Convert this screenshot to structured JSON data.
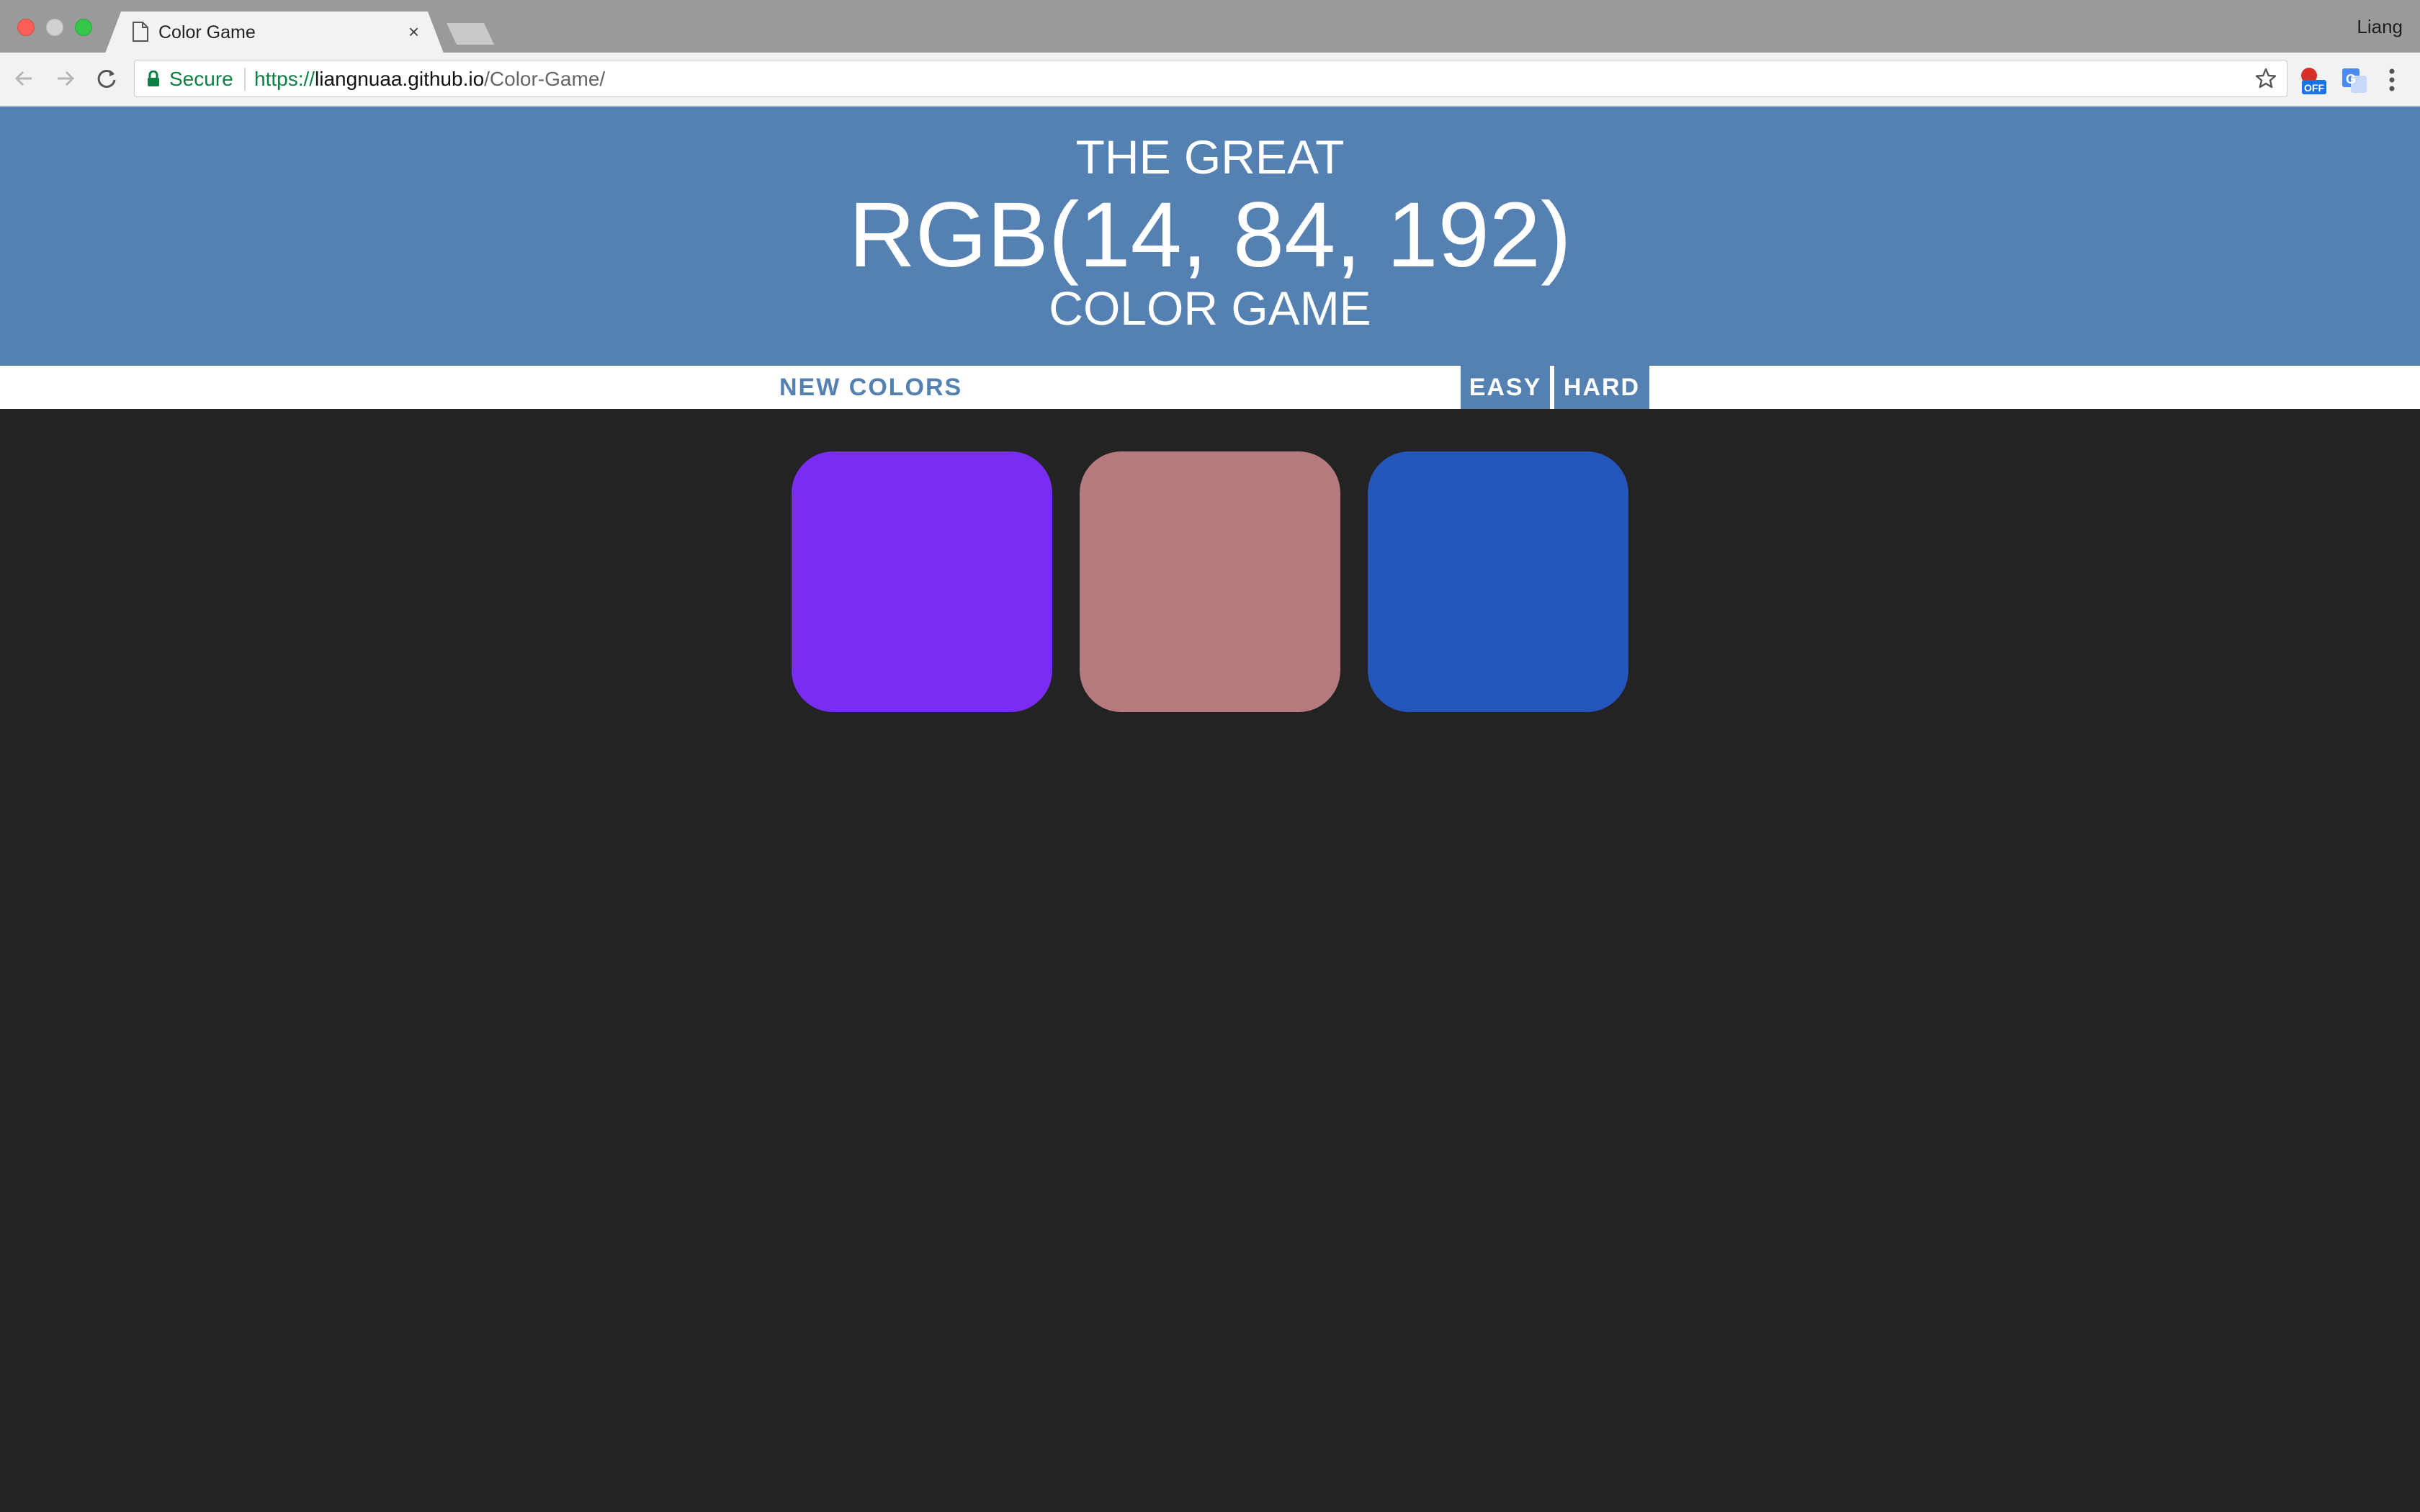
{
  "browser": {
    "tab_title": "Color Game",
    "tab_close": "×",
    "profile_name": "Liang",
    "secure_label": "Secure",
    "url_scheme": "https://",
    "url_host": "liangnuaa.github.io",
    "url_path": "/Color-Game/"
  },
  "header": {
    "line1": "THE GREAT",
    "rgb": "RGB(14, 84, 192)",
    "line3": "COLOR GAME",
    "background": "#5480b2"
  },
  "stripe": {
    "new_colors_label": "NEW COLORS",
    "easy_label": "EASY",
    "hard_label": "HARD",
    "selected_mode": "EASY"
  },
  "squares": [
    {
      "color": "#7b2cf2"
    },
    {
      "color": "#b77a7f"
    },
    {
      "color": "#2556bc"
    }
  ],
  "page_background": "#232323"
}
